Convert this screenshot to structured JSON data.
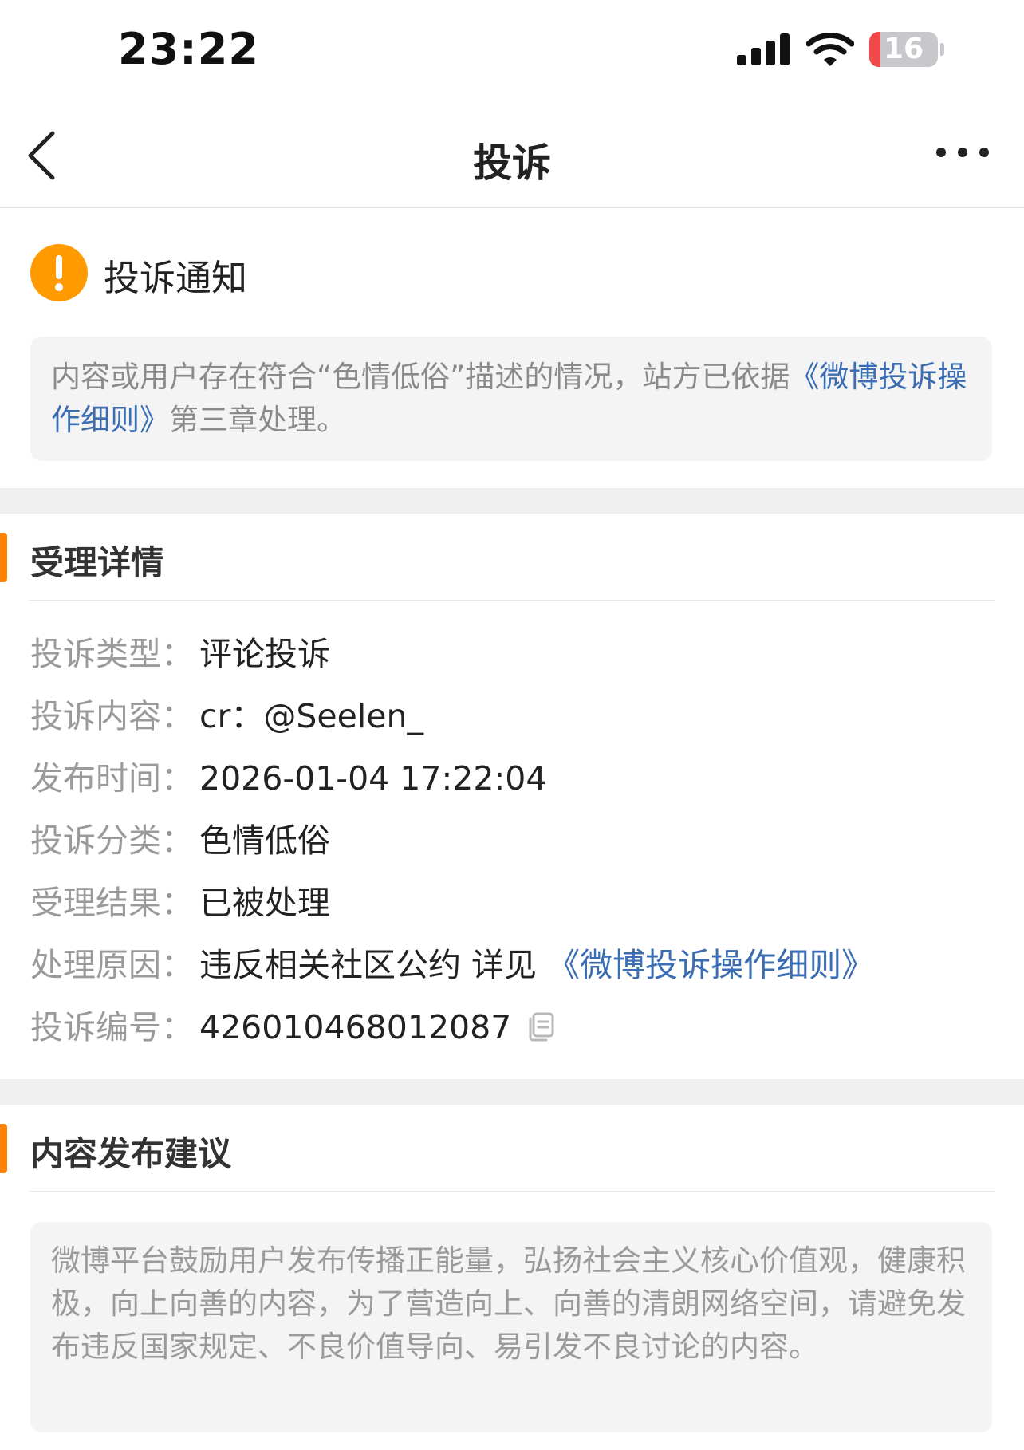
{
  "status_bar": {
    "time": "23:22",
    "battery_level": "16",
    "battery_fraction": 0.16,
    "icons": [
      "signal-icon",
      "wifi-icon",
      "battery-icon"
    ]
  },
  "nav": {
    "title": "投诉",
    "back_icon": "chevron-left-icon",
    "more_icon": "more-dots-icon"
  },
  "notice": {
    "title": "投诉通知",
    "icon": "warning-icon",
    "text_before": "内容或用户存在符合“色情低俗”描述的情况，站方已依据",
    "link": "《微博投诉操作细则》",
    "text_after": "第三章处理。"
  },
  "details": {
    "section_title": "受理详情",
    "rows": [
      {
        "label": "投诉类型：",
        "value": "评论投诉"
      },
      {
        "label": "投诉内容：",
        "value": "cr：@Seelen_"
      },
      {
        "label": "发布时间：",
        "value": "2026-01-04 17:22:04"
      },
      {
        "label": "投诉分类：",
        "value": "色情低俗"
      },
      {
        "label": "受理结果：",
        "value": "已被处理"
      },
      {
        "label": "处理原因：",
        "value": "违反相关社区公约 详见",
        "link": "《微博投诉操作细则》"
      },
      {
        "label": "投诉编号：",
        "value": "426010468012087",
        "icon": "copy-icon"
      }
    ]
  },
  "advice": {
    "section_title": "内容发布建议",
    "text": "微博平台鼓励用户发布传播正能量，弘扬社会主义核心价值观，健康积极，向上向善的内容，为了营造向上、向善的清朗网络空间，请避免发布违反国家规定、不良价值导向、易引发不良讨论的内容。"
  },
  "colors": {
    "accent": "#ff8200",
    "link": "#3b6db3",
    "warning": "#ff9a00",
    "battery_low": "#f04848"
  }
}
